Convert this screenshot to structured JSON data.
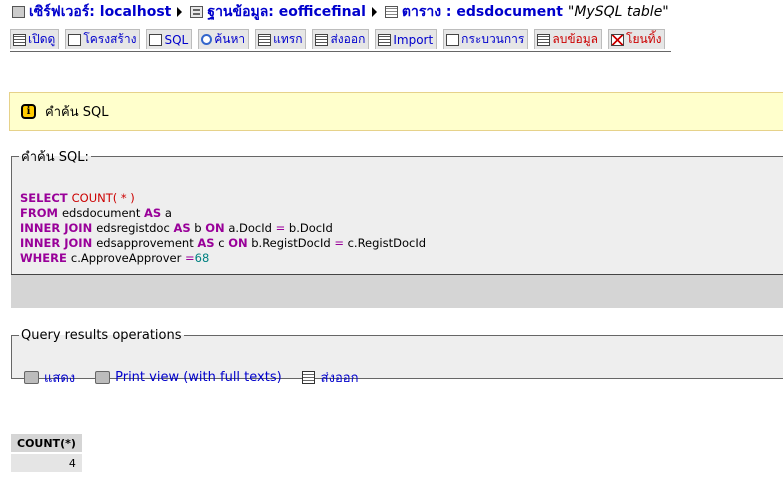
{
  "breadcrumb": {
    "server_label": "เซิร์ฟเวอร์: localhost",
    "database_label": "ฐานข้อมูล: eofficefinal",
    "table_label": "ตาราง : edsdocument",
    "table_note": "\"MySQL table\""
  },
  "tabs": [
    {
      "label": "เปิดดู",
      "icon": "browse-icon"
    },
    {
      "label": "โครงสร้าง",
      "icon": "structure-icon"
    },
    {
      "label": "SQL",
      "icon": "sql-icon"
    },
    {
      "label": "ค้นหา",
      "icon": "search-icon"
    },
    {
      "label": "แทรก",
      "icon": "insert-icon"
    },
    {
      "label": "ส่งออก",
      "icon": "export-icon"
    },
    {
      "label": "Import",
      "icon": "import-icon"
    },
    {
      "label": "กระบวนการ",
      "icon": "operations-icon"
    },
    {
      "label": "ลบข้อมูล",
      "icon": "empty-icon"
    },
    {
      "label": "โยนทิ้ง",
      "icon": "drop-icon"
    }
  ],
  "notice": {
    "icon": "info-icon",
    "text": "คำค้น SQL"
  },
  "sql_box": {
    "legend": "คำค้น SQL:",
    "lines": [
      [
        {
          "t": "SELECT ",
          "c": "kw"
        },
        {
          "t": "COUNT( * )",
          "c": "fn"
        }
      ],
      [
        {
          "t": "FROM ",
          "c": "kw"
        },
        {
          "t": "edsdocument ",
          "c": ""
        },
        {
          "t": "AS",
          "c": "kw"
        },
        {
          "t": " a",
          "c": ""
        }
      ],
      [
        {
          "t": "INNER JOIN ",
          "c": "kw"
        },
        {
          "t": "edsregistdoc ",
          "c": ""
        },
        {
          "t": "AS",
          "c": "kw"
        },
        {
          "t": " b ",
          "c": ""
        },
        {
          "t": "ON",
          "c": "kw"
        },
        {
          "t": " a.DocId ",
          "c": ""
        },
        {
          "t": "=",
          "c": "op"
        },
        {
          "t": " b.DocId",
          "c": ""
        }
      ],
      [
        {
          "t": "INNER JOIN ",
          "c": "kw"
        },
        {
          "t": "edsapprovement ",
          "c": ""
        },
        {
          "t": "AS",
          "c": "kw"
        },
        {
          "t": " c ",
          "c": ""
        },
        {
          "t": "ON",
          "c": "kw"
        },
        {
          "t": " b.RegistDocId ",
          "c": ""
        },
        {
          "t": "=",
          "c": "op"
        },
        {
          "t": " c.RegistDocId",
          "c": ""
        }
      ],
      [
        {
          "t": "WHERE ",
          "c": "kw"
        },
        {
          "t": "c.ApproveApprover ",
          "c": ""
        },
        {
          "t": "=",
          "c": "op"
        },
        {
          "t": "68",
          "c": "num"
        }
      ]
    ]
  },
  "query_ops": {
    "legend": "Query results operations",
    "print_label": "แสดง",
    "print_full_label": "Print view (with full texts)",
    "export_label": "ส่งออก"
  },
  "results": {
    "header": "COUNT(*)",
    "value": "4"
  }
}
